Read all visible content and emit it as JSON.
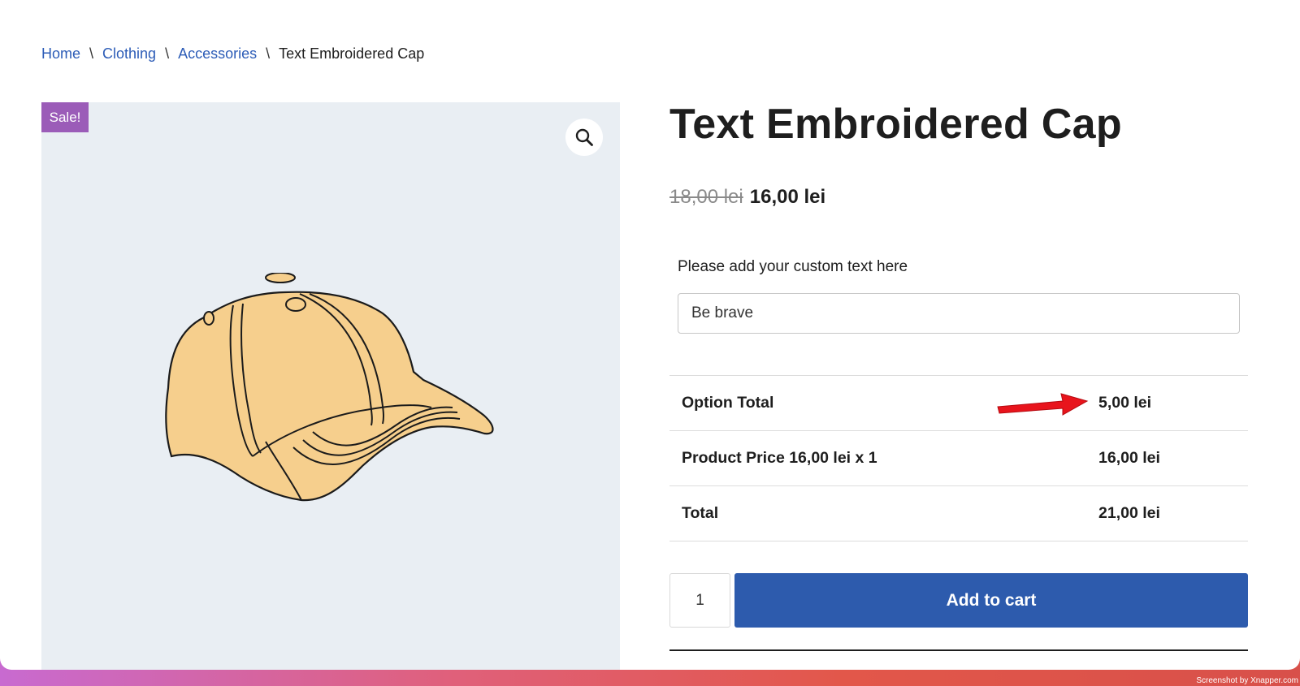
{
  "breadcrumb": {
    "home": "Home",
    "clothing": "Clothing",
    "accessories": "Accessories",
    "separator": "\\",
    "current": "Text Embroidered Cap"
  },
  "gallery": {
    "sale_badge": "Sale!",
    "zoom_icon": "magnifier-icon"
  },
  "product": {
    "title": "Text Embroidered Cap",
    "price_old": "18,00 lei",
    "price_new": "16,00 lei"
  },
  "custom_text": {
    "label": "Please add your custom text here",
    "value": "Be brave"
  },
  "totals": [
    {
      "label": "Option Total",
      "value": "5,00 lei"
    },
    {
      "label": "Product Price 16,00 lei x 1",
      "value": "16,00 lei"
    },
    {
      "label": "Total",
      "value": "21,00 lei"
    }
  ],
  "cart": {
    "quantity": "1",
    "add_to_cart": "Add to cart"
  },
  "colors": {
    "link": "#2c5cb7",
    "sale_badge": "#9b5cb8",
    "button": "#2d5bad",
    "annotation_arrow": "#e8141c"
  },
  "watermark": "Screenshot by Xnapper.com"
}
